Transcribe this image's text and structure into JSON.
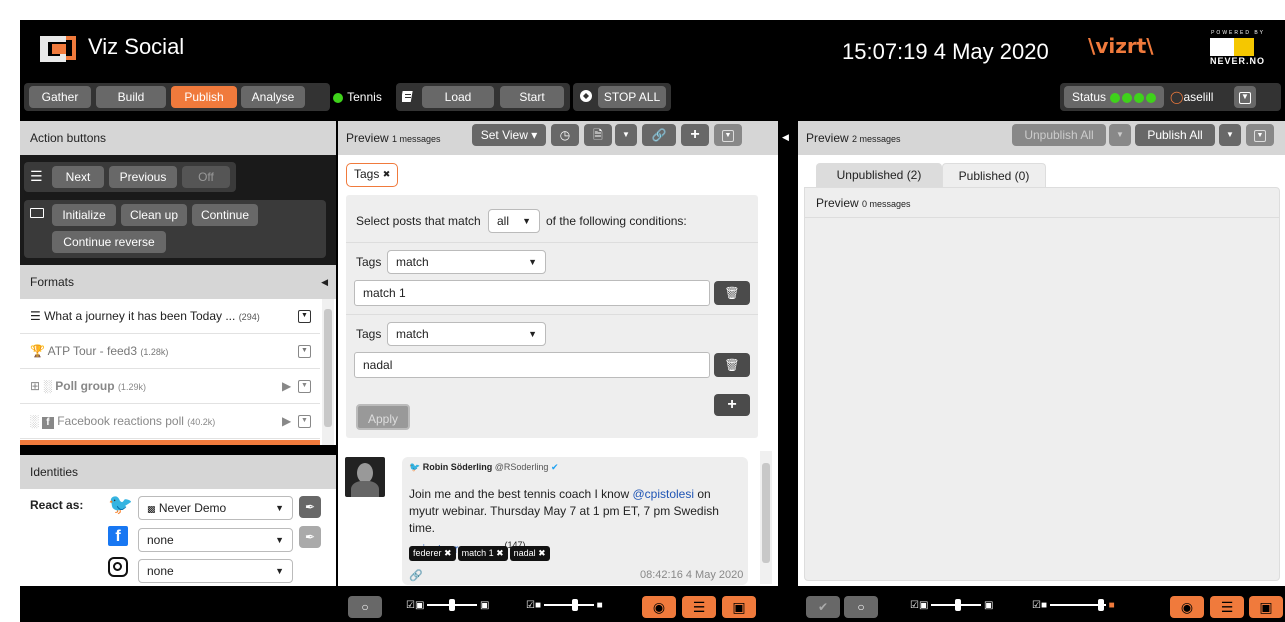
{
  "app": {
    "title": "Viz Social",
    "clock": "15:07:19 4 May 2020",
    "vizrt_logo": "vizrt",
    "never_logo_top": "POWERED BY",
    "never_logo": "NEVER.NO"
  },
  "nav": {
    "gather": "Gather",
    "build": "Build",
    "publish": "Publish",
    "analyse": "Analyse",
    "channel": "Tennis",
    "load": "Load",
    "start": "Start",
    "stop_all": "STOP ALL",
    "status": "Status",
    "user": "aselill"
  },
  "action_buttons": {
    "title": "Action buttons",
    "row1": {
      "next": "Next",
      "previous": "Previous",
      "off": "Off"
    },
    "row2": {
      "initialize": "Initialize",
      "clean_up": "Clean up",
      "continue": "Continue",
      "continue_reverse": "Continue reverse"
    }
  },
  "formats": {
    "title": "Formats",
    "items": [
      {
        "label": "What a journey it has been Today ...",
        "count": "(294)"
      },
      {
        "label": "ATP Tour - feed3",
        "count": "(1.28k)"
      },
      {
        "label": "Poll group",
        "count": "(1.29k)"
      },
      {
        "label": "Facebook reactions poll",
        "count": "(40.2k)"
      }
    ]
  },
  "identities": {
    "title": "Identities",
    "react_as": "React as:",
    "twitter_value": "Never Demo",
    "facebook_value": "none",
    "instagram_value": "none"
  },
  "preview_mid": {
    "title": "Preview",
    "count": "1 messages",
    "set_view": "Set View",
    "tag_chip": "Tags",
    "condition_prefix": "Select posts that match",
    "condition_select": "all",
    "condition_suffix": "of the following conditions:",
    "cond1_label": "Tags",
    "cond1_select": "match",
    "cond1_value": "match 1",
    "cond2_label": "Tags",
    "cond2_select": "match",
    "cond2_value": "nadal",
    "apply": "Apply",
    "post": {
      "author": "Robin Söderling",
      "handle": "@RSoderling",
      "text1": "Join me and the best tennis coach I know ",
      "mention": "@cpistolesi",
      "text2": " on myutr webinar. Thursday May 7 at 1 pm ET, 7 pm Swedish time.",
      "link": "instagram.com",
      "link_count": "(147)",
      "tags": [
        "federer",
        "match 1",
        "nadal"
      ],
      "time": "08:42:16 4 May 2020"
    }
  },
  "preview_right": {
    "title": "Preview",
    "count": "2 messages",
    "unpublish_all": "Unpublish All",
    "publish_all": "Publish All",
    "tab_unpublished": "Unpublished (2)",
    "tab_published": "Published (0)",
    "inner_title": "Preview",
    "inner_count": "0 messages"
  },
  "colors": {
    "accent": "#f07a3c",
    "status_green": "#3fd21b",
    "twitter_blue": "#1da1f2",
    "facebook_blue": "#1877f2"
  }
}
